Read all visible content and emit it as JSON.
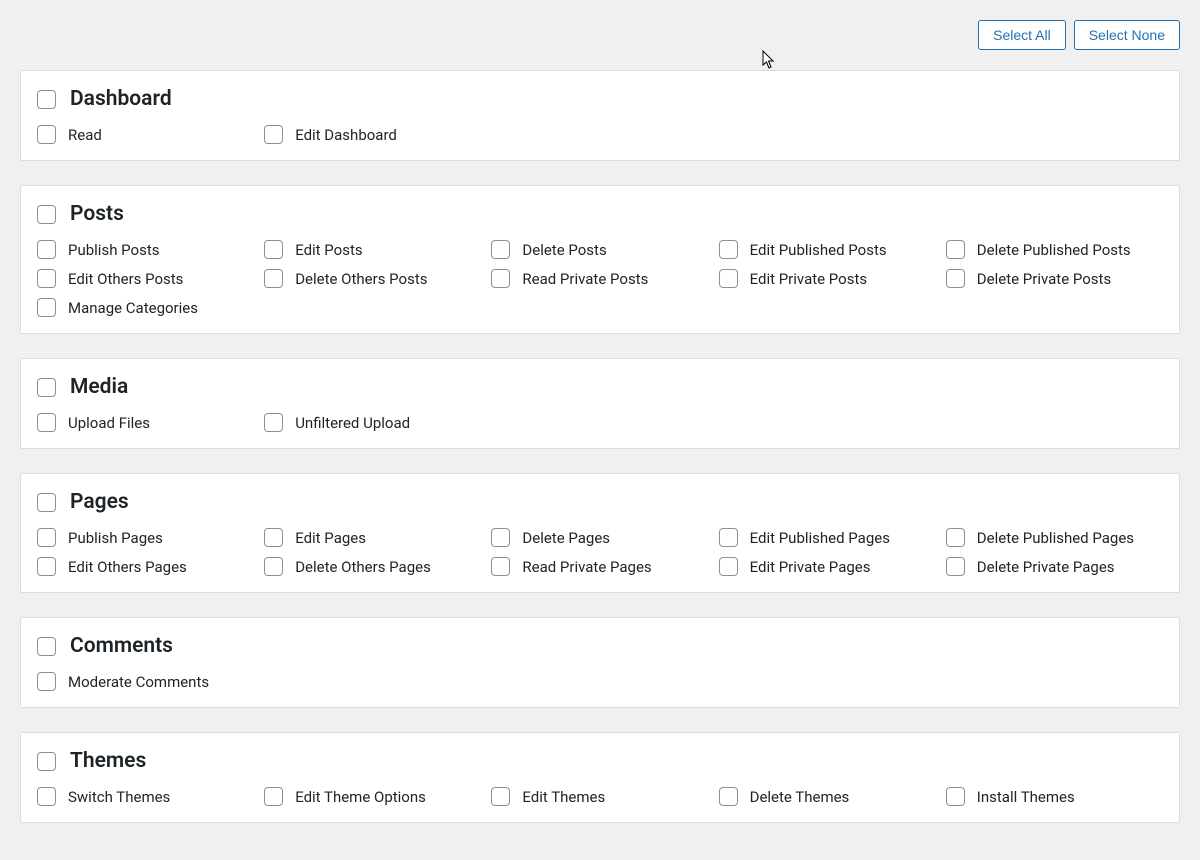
{
  "toolbar": {
    "select_all": "Select All",
    "select_none": "Select None"
  },
  "groups": [
    {
      "title": "Dashboard",
      "caps": [
        "Read",
        "Edit Dashboard"
      ]
    },
    {
      "title": "Posts",
      "caps": [
        "Publish Posts",
        "Edit Posts",
        "Delete Posts",
        "Edit Published Posts",
        "Delete Published Posts",
        "Edit Others Posts",
        "Delete Others Posts",
        "Read Private Posts",
        "Edit Private Posts",
        "Delete Private Posts",
        "Manage Categories"
      ]
    },
    {
      "title": "Media",
      "caps": [
        "Upload Files",
        "Unfiltered Upload"
      ]
    },
    {
      "title": "Pages",
      "caps": [
        "Publish Pages",
        "Edit Pages",
        "Delete Pages",
        "Edit Published Pages",
        "Delete Published Pages",
        "Edit Others Pages",
        "Delete Others Pages",
        "Read Private Pages",
        "Edit Private Pages",
        "Delete Private Pages"
      ]
    },
    {
      "title": "Comments",
      "caps": [
        "Moderate Comments"
      ]
    },
    {
      "title": "Themes",
      "caps": [
        "Switch Themes",
        "Edit Theme Options",
        "Edit Themes",
        "Delete Themes",
        "Install Themes"
      ]
    }
  ]
}
